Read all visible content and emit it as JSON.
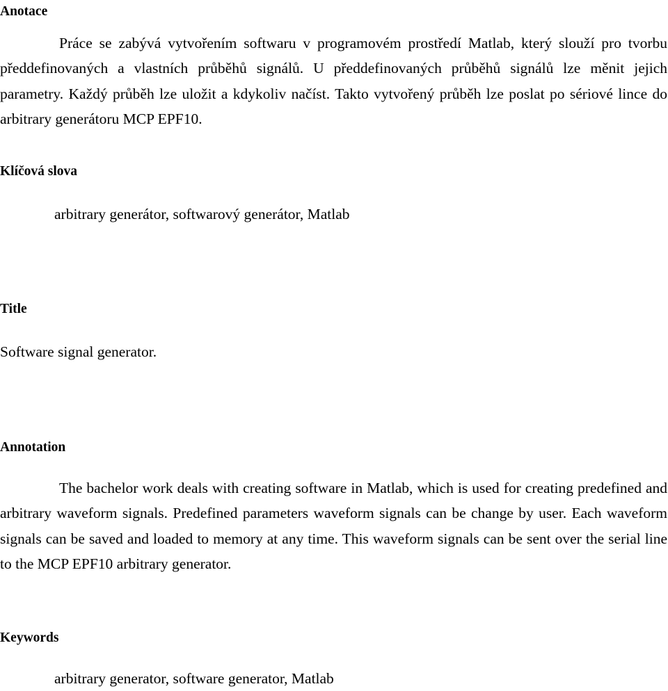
{
  "document": {
    "language_primary": "cs",
    "language_secondary": "en",
    "sections": {
      "anotace": {
        "heading": "Anotace",
        "body": "Práce se zabývá vytvořením softwaru v programovém prostředí Matlab, který slouží pro tvorbu předdefinovaných a  vlastních průběhů signálů. U předdefinovaných průběhů signálů lze měnit jejich parametry. Každý průběh lze uložit a kdykoliv načíst. Takto vytvořený průběh lze poslat po sériové lince do arbitrary generátoru MCP EPF10."
      },
      "klicova_slova": {
        "heading": "Klíčová slova",
        "body": "arbitrary generátor, softwarový generátor, Matlab"
      },
      "title": {
        "heading": "Title",
        "body": "Software signal generator."
      },
      "annotation": {
        "heading": "Annotation",
        "body": "The bachelor work deals with creating software in Matlab, which is used for creating predefined and arbitrary waveform signals. Predefined parameters waveform signals can be change by user. Each waveform signals can be saved and loaded to memory at any time. This waveform signals can be sent over the serial line to the MCP EPF10 arbitrary generator."
      },
      "keywords": {
        "heading": "Keywords",
        "body": "arbitrary generator, software generator, Matlab"
      }
    },
    "colors": {
      "text": "#000000",
      "background": "#ffffff"
    }
  }
}
